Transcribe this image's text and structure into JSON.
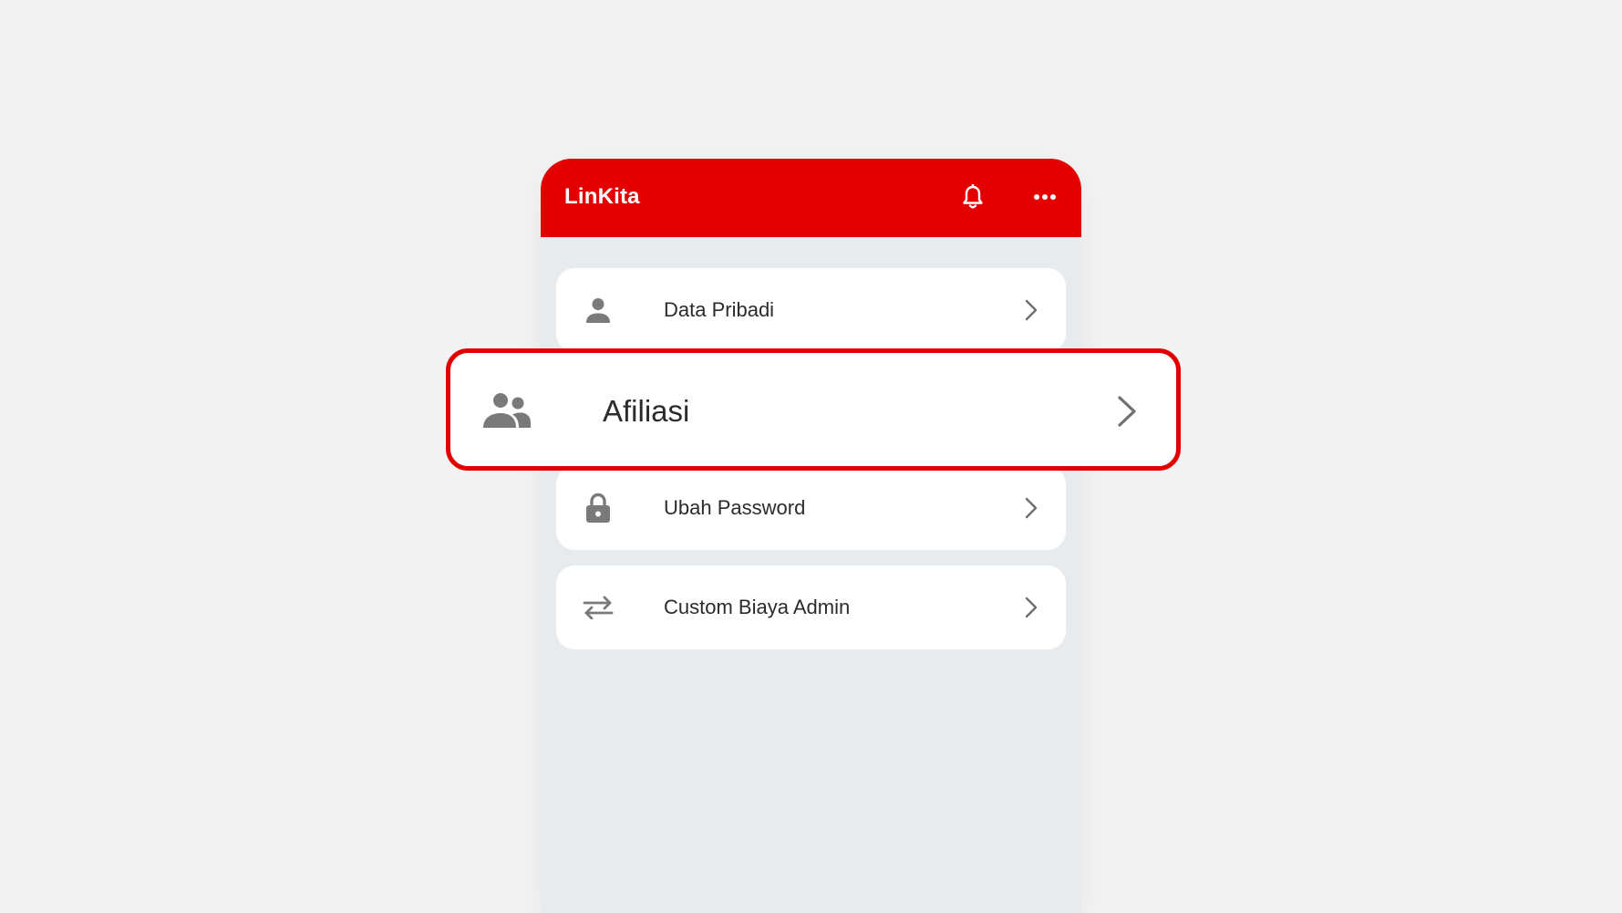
{
  "app": {
    "title": "LinKita",
    "accent_color": "#e30000"
  },
  "header": {
    "icons": [
      "bell-icon",
      "more-horizontal-icon"
    ]
  },
  "menu": {
    "items": [
      {
        "label": "Data Pribadi",
        "icon": "person-icon"
      },
      {
        "label": "Afiliasi",
        "icon": "group-icon",
        "highlighted": true
      },
      {
        "label": "Ubah Password",
        "icon": "lock-icon"
      },
      {
        "label": "Custom Biaya Admin",
        "icon": "swap-arrows-icon"
      }
    ]
  }
}
